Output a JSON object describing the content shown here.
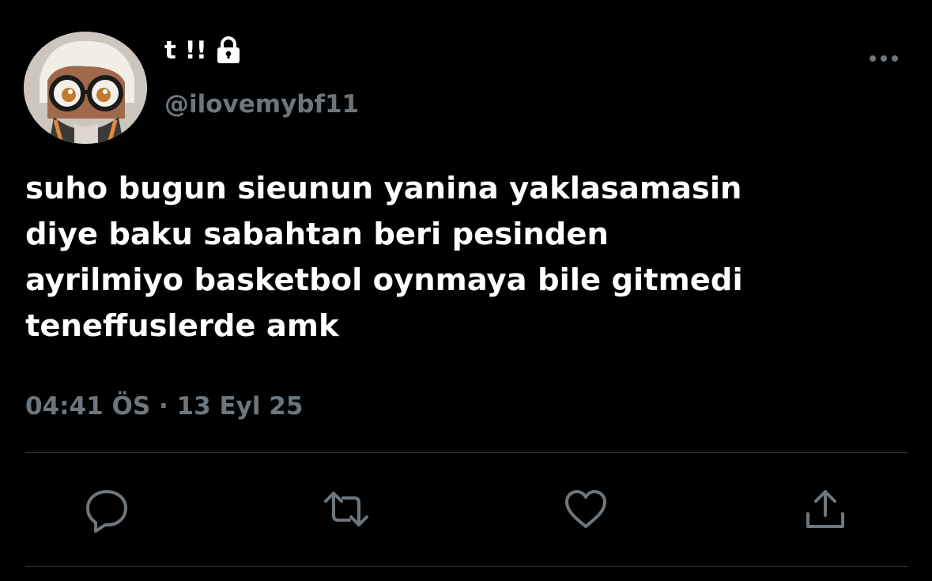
{
  "tweet": {
    "display_name": "t !!",
    "handle": "@ilovemybf11",
    "text_lines": [
      "suho bugun sieunun yanina yaklasamasin",
      "diye baku sabahtan beri pesinden",
      "ayrilmiyo basketbol oynmaya bile gitmedi",
      "teneffuslerde amk"
    ],
    "timestamp": "04:41 ÖS · 13 Eyl 25"
  },
  "icons": {
    "lock": "lock-icon",
    "more": "more-horizontal-icon",
    "reply": "reply-icon",
    "retweet": "retweet-icon",
    "like": "heart-icon",
    "share": "share-icon"
  },
  "colors": {
    "background": "#000000",
    "text": "#ffffff",
    "secondary": "#6e767d",
    "divider": "#2f3336"
  }
}
